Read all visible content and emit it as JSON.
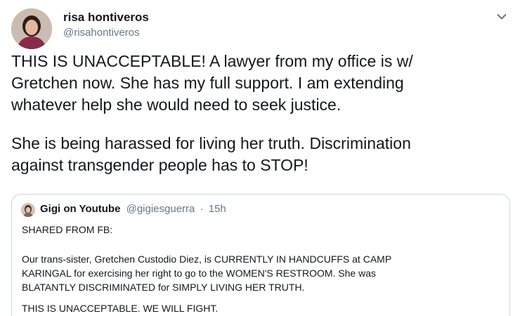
{
  "tweet": {
    "author_name": "risa hontiveros",
    "author_handle": "@risahontiveros",
    "lines": [
      "THIS IS UNACCEPTABLE! A lawyer from my office is w/",
      "Gretchen now. She has my full support. I am extending",
      "whatever help she would need to seek justice.",
      "She is being harassed for living her truth. Discrimination",
      "against transgender people has to STOP!"
    ]
  },
  "quoted": {
    "author_name": "Gigi on Youtube",
    "author_handle": "@gigiesguerra",
    "separator": "·",
    "time": "15h",
    "lines": [
      "SHARED FROM FB:",
      "Our trans-sister, Gretchen Custodio Diez, is CURRENTLY IN HANDCUFFS at CAMP",
      "KARINGAL for exercising her right to go to the WOMEN'S RESTROOM. She was",
      "BLATANTLY DISCRIMINATED for SIMPLY LIVING HER TRUTH.",
      "THIS IS UNACCEPTABLE. WE WILL FIGHT."
    ]
  },
  "icons": {
    "menu": "chevron-down-icon",
    "avatar": "avatar",
    "quoted_avatar": "avatar"
  },
  "colors": {
    "text": "#14171a",
    "secondary": "#657786",
    "border": "#ccd6dd"
  }
}
